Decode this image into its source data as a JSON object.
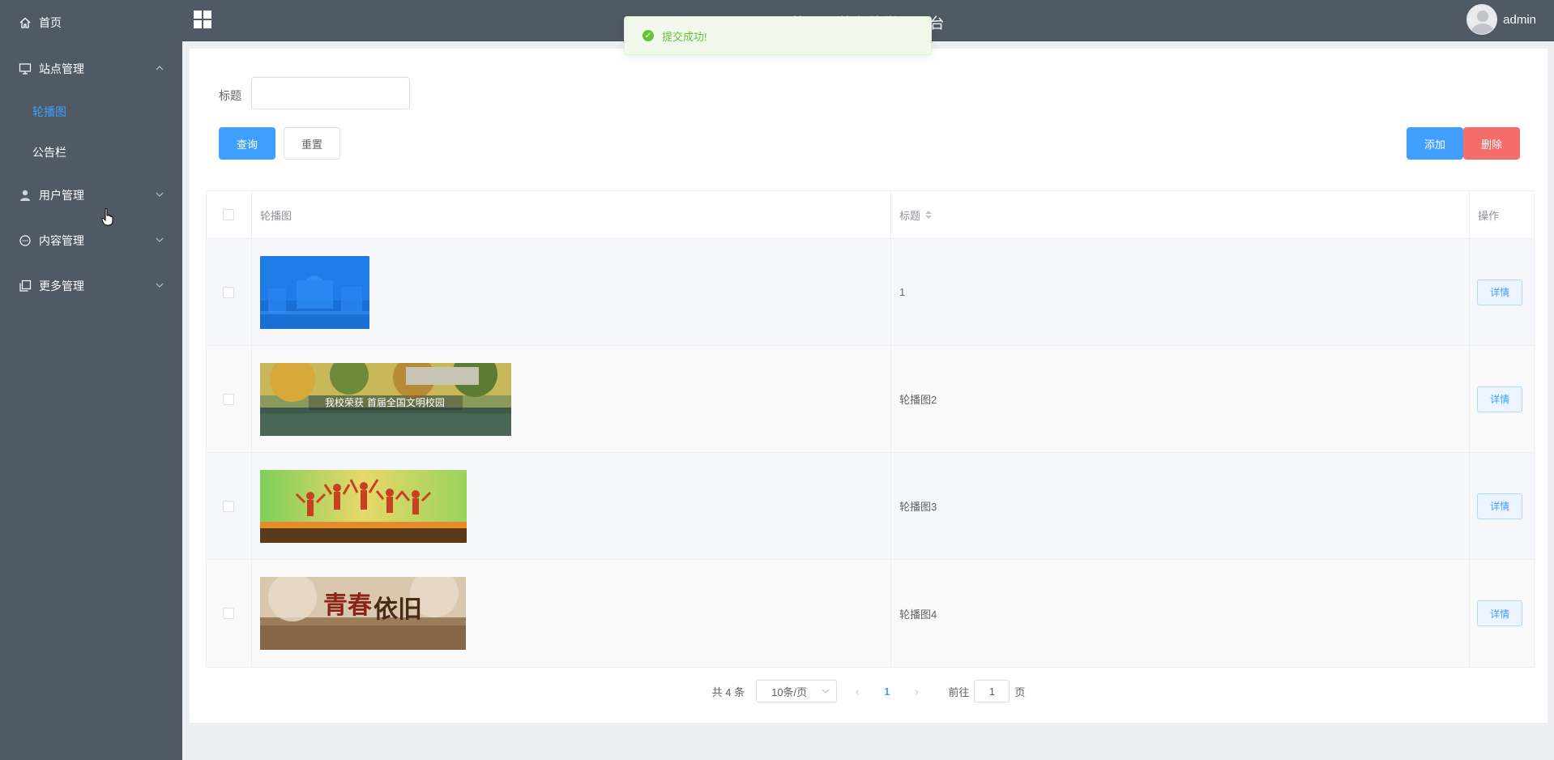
{
  "app": {
    "site_title": "校园公共在线学习平台"
  },
  "sidebar": {
    "items": [
      {
        "label": "首页",
        "icon": "home-icon"
      },
      {
        "label": "站点管理",
        "icon": "monitor-icon",
        "expanded": true,
        "children": [
          {
            "label": "轮播图",
            "active": true
          },
          {
            "label": "公告栏",
            "active": false
          }
        ]
      },
      {
        "label": "用户管理",
        "icon": "user-icon",
        "expanded": false
      },
      {
        "label": "内容管理",
        "icon": "chat-icon",
        "expanded": false
      },
      {
        "label": "更多管理",
        "icon": "copy-icon",
        "expanded": false
      }
    ]
  },
  "header": {
    "username": "admin"
  },
  "toast": {
    "message": "提交成功!",
    "type": "success"
  },
  "search": {
    "label": "标题",
    "value": "",
    "query_label": "查询",
    "reset_label": "重置"
  },
  "actions": {
    "add_label": "添加",
    "delete_label": "删除"
  },
  "table": {
    "columns": {
      "image": "轮播图",
      "title": "标题",
      "ops": "操作"
    },
    "rows": [
      {
        "title": "1",
        "detail_label": "详情",
        "image": "blue-campus-photo"
      },
      {
        "title": "轮播图2",
        "detail_label": "详情",
        "image": "campus-autumn-banner"
      },
      {
        "title": "轮播图3",
        "detail_label": "详情",
        "image": "youth-jumping-banner"
      },
      {
        "title": "轮播图4",
        "detail_label": "详情",
        "image": "qingchun-yijiu-banner"
      }
    ]
  },
  "pagination": {
    "total_text": "共 4 条",
    "page_size": "10条/页",
    "current_page": "1",
    "goto_label": "前往",
    "goto_value": "1",
    "page_suffix": "页"
  },
  "colors": {
    "sidebar_bg": "#505a64",
    "primary": "#409eff",
    "danger": "#f56c6c",
    "success": "#67c23a"
  }
}
